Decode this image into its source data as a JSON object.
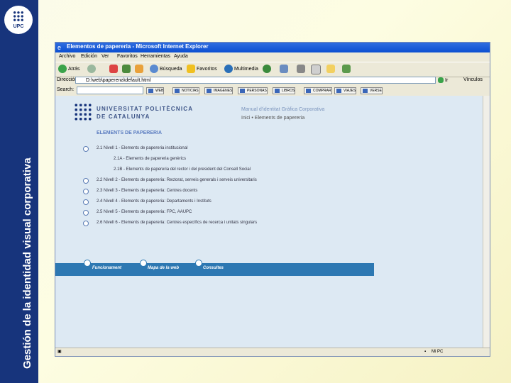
{
  "sidebar": {
    "logo_text": "UPC",
    "vertical_title": "Gestión de la identidad visual corporativa"
  },
  "browser": {
    "title": "Elementos de papereria - Microsoft Internet Explorer",
    "menu": [
      "Archivo",
      "Edición",
      "Ver",
      "Favoritos",
      "Herramientas",
      "Ayuda"
    ],
    "toolbar": {
      "back": "Atrás",
      "search": "Búsqueda",
      "favorites": "Favoritos",
      "multimedia": "Multimedia"
    },
    "address_label": "Dirección",
    "address_value": "D:\\web\\paperena\\default.html",
    "go_label": "Ir",
    "links_label": "Vínculos",
    "search_label": "Search:",
    "search_value": "",
    "search_buttons": [
      "WEB",
      "NOTICIAS",
      "IMAGENES",
      "PERSONAS",
      "LIBROS",
      "COMPRAR",
      "VIAJES",
      "VERSE"
    ],
    "status_right": "Mi PC"
  },
  "page": {
    "university_line1": "UNIVERSITAT POLITÈCNICA",
    "university_line2": "DE CATALUNYA",
    "manual_title": "Manual d'identitat Gràfica Corporativa",
    "manual_subtitle": "Inici  •  Elements de papereria",
    "section_title": "ELEMENTS DE PAPERERIA",
    "items": [
      {
        "text": "2.1  Nivell 1 - Elements de papereria institucional",
        "bullet": true,
        "indent": false
      },
      {
        "text": "2.1A - Elements de papereria genèrics",
        "bullet": false,
        "indent": true
      },
      {
        "text": "2.1B - Elements de papereria del rector i del president del Consell Social",
        "bullet": false,
        "indent": true
      },
      {
        "text": "2.2  Nivell 2 - Elements de papereria: Rectorat, serveis generals i serveis universitaris",
        "bullet": true,
        "indent": false
      },
      {
        "text": "2.3  Nivell 3 - Elements de papereria: Centres docents",
        "bullet": true,
        "indent": false
      },
      {
        "text": "2.4  Nivell 4 - Elements de papereria: Departaments i Instituts",
        "bullet": true,
        "indent": false
      },
      {
        "text": "2.5  Nivell 5 - Elements de papereria: FPC, AAUPC",
        "bullet": true,
        "indent": false
      },
      {
        "text": "2.6  Nivell 6 - Elements de papereria: Centres específics de recerca i unitats singulars",
        "bullet": true,
        "indent": false
      }
    ],
    "nav": [
      "Funcionament",
      "Mapa de la web",
      "Consultes"
    ]
  },
  "colors": {
    "band": "#17347c",
    "nav": "#2d78b2",
    "titlebar": "#0b4fd1"
  }
}
